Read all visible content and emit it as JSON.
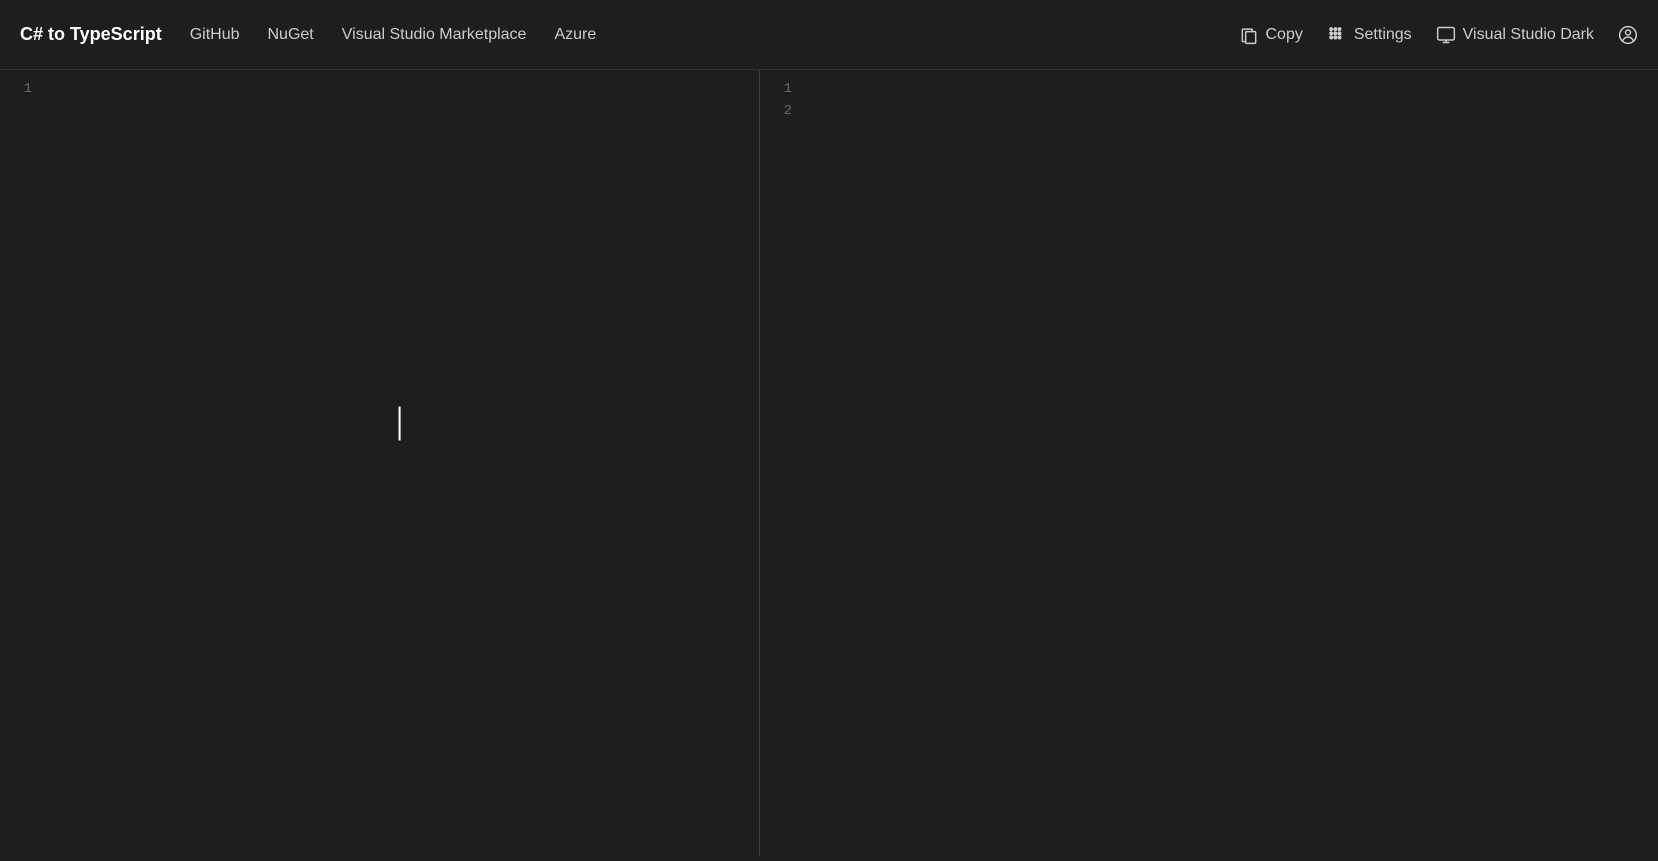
{
  "app": {
    "title": "C# to TypeScript",
    "bg_color": "#1e1e1e"
  },
  "navbar": {
    "brand": "C# to TypeScript",
    "links": [
      {
        "label": "GitHub",
        "url": "#github"
      },
      {
        "label": "NuGet",
        "url": "#nuget"
      },
      {
        "label": "Visual Studio Marketplace",
        "url": "#marketplace"
      },
      {
        "label": "Azure",
        "url": "#azure"
      }
    ],
    "actions": [
      {
        "id": "copy",
        "label": "Copy",
        "icon": "copy-icon"
      },
      {
        "id": "settings",
        "label": "Settings",
        "icon": "settings-icon"
      },
      {
        "id": "theme",
        "label": "Visual Studio Dark",
        "icon": "theme-icon"
      },
      {
        "id": "user",
        "label": "",
        "icon": "user-icon"
      }
    ]
  },
  "left_panel": {
    "line_numbers": [
      "1"
    ]
  },
  "right_panel": {
    "line_numbers": [
      "1",
      "2"
    ]
  }
}
